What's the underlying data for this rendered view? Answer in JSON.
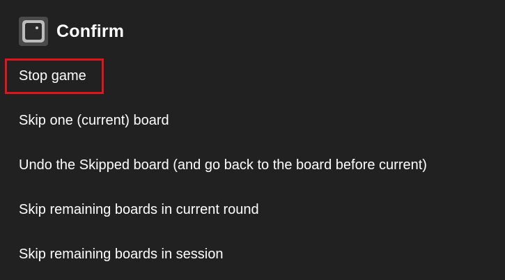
{
  "dialog": {
    "title": "Confirm",
    "icon": "app-icon",
    "items": [
      {
        "label": "Stop game"
      },
      {
        "label": "Skip one (current) board"
      },
      {
        "label": "Undo the Skipped board (and go back to the board before current)"
      },
      {
        "label": "Skip remaining boards in current round"
      },
      {
        "label": "Skip remaining boards in session"
      }
    ]
  },
  "colors": {
    "background": "#212121",
    "text": "#ffffff",
    "highlight": "#e0141b"
  }
}
